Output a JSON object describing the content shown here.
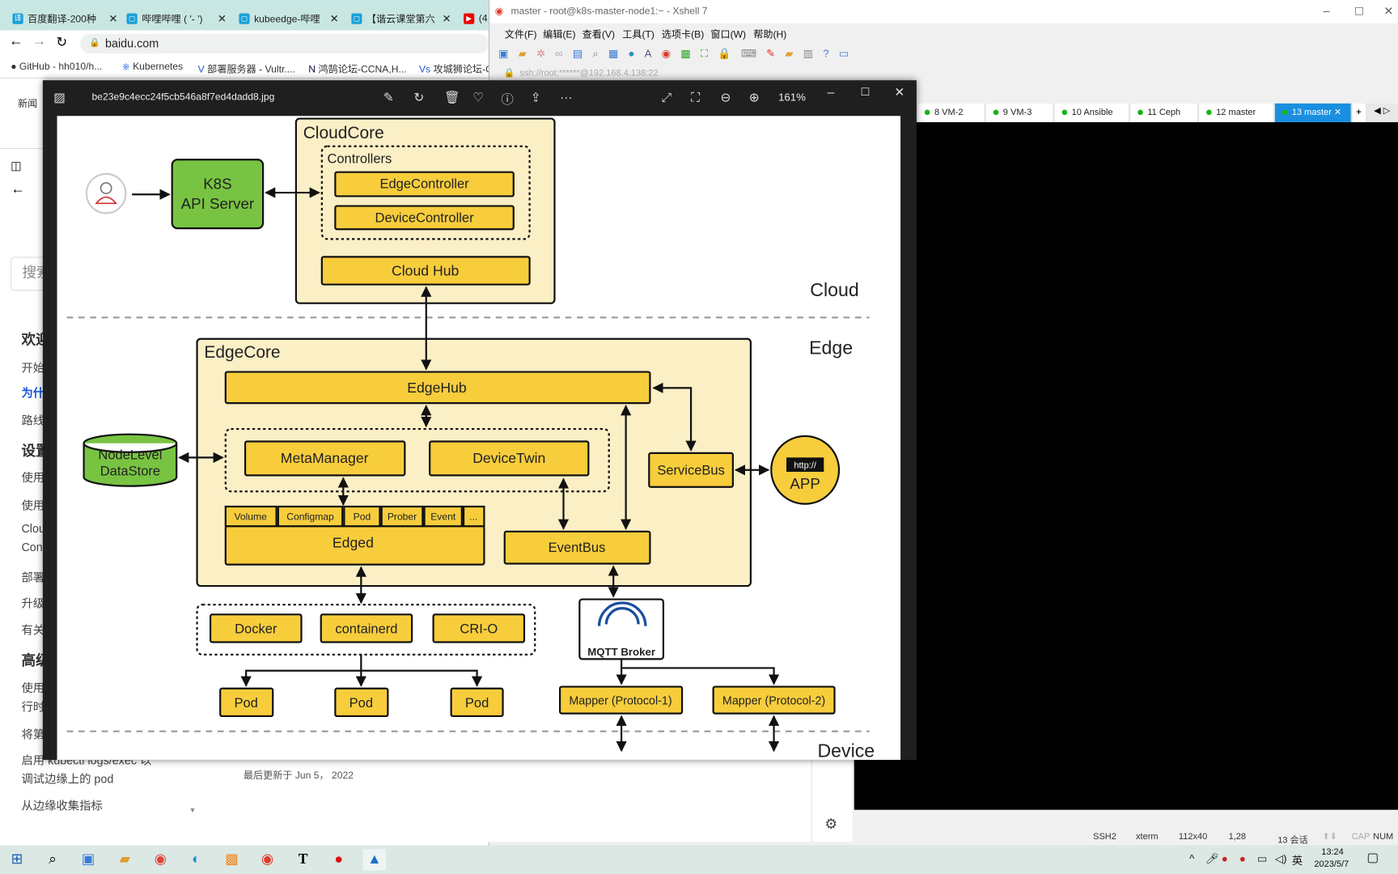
{
  "browser": {
    "tabs": [
      {
        "label": "百度翻译-200种",
        "icon": "translate-icon"
      },
      {
        "label": "哔哩哔哩 ( '- ')",
        "icon": "bilibili-icon"
      },
      {
        "label": "kubeedge-哔哩",
        "icon": "bilibili-icon"
      },
      {
        "label": "【谐云课堂第六",
        "icon": "bilibili-icon"
      },
      {
        "label": "(4",
        "icon": "youtube-icon"
      }
    ],
    "url": "baidu.com",
    "bookmarks": [
      "GitHub - hh010/h...",
      "Kubernetes",
      "部署服务器 - Vultr....",
      "鸿鹄论坛-CCNA,H...",
      "攻城狮论坛-C"
    ],
    "nav_news": "新闻",
    "search_placeholder": "搜索",
    "sidebar": [
      "欢迎",
      "开始",
      "为什",
      "路线",
      "设置",
      "使用",
      "使用",
      "Clou",
      "Con",
      "部署",
      "升级",
      "有关",
      "高级",
      "使用",
      "行时",
      "将第",
      "启用 kubectl logs/exec 以",
      "调试边缘上的 pod",
      "从边缘收集指标"
    ],
    "last_updated": "最后更新于 Jun 5， 2022"
  },
  "xshell": {
    "title": "master - root@k8s-master-node1:~ - Xshell 7",
    "menu": [
      "文件(F)",
      "编辑(E)",
      "查看(V)",
      "工具(T)",
      "选项卡(B)",
      "窗口(W)",
      "帮助(H)"
    ],
    "address": "ssh://root:******@192.168.4.138:22",
    "sessions": [
      {
        "num": "8",
        "name": "VM-2"
      },
      {
        "num": "9",
        "name": "VM-3"
      },
      {
        "num": "10",
        "name": "Ansible"
      },
      {
        "num": "11",
        "name": "Ceph"
      },
      {
        "num": "12",
        "name": "master"
      },
      {
        "num": "13",
        "name": "master",
        "active": true
      }
    ],
    "status": {
      "protocol": "SSH2",
      "term": "xterm",
      "size": "112x40",
      "cursor": "1,28",
      "sessions": "13 会话",
      "cap": "CAP",
      "num": "NUM"
    }
  },
  "viewer": {
    "filename": "be23e9c4ecc24f5cb546a8f7ed4dadd8.jpg",
    "zoom": "161%",
    "diagram": {
      "cloudcore": "CloudCore",
      "controllers": "Controllers",
      "edgecontroller": "EdgeController",
      "devicecontroller": "DeviceController",
      "cloudhub": "Cloud Hub",
      "k8s1": "K8S",
      "k8s2": "API Server",
      "cloud": "Cloud",
      "edge": "Edge",
      "device": "Device",
      "edgecore": "EdgeCore",
      "edgehub": "EdgeHub",
      "metamanager": "MetaManager",
      "devicetwin": "DeviceTwin",
      "nodelevel1": "NodeLevel",
      "nodelevel2": "DataStore",
      "servicebus": "ServiceBus",
      "http": "http://",
      "app": "APP",
      "edged_tabs": [
        "Volume",
        "Configmap",
        "Pod",
        "Prober",
        "Event",
        "..."
      ],
      "edged": "Edged",
      "eventbus": "EventBus",
      "docker": "Docker",
      "containerd": "containerd",
      "crio": "CRI-O",
      "mqtt": "MQTT Broker",
      "pods": [
        "Pod",
        "Pod",
        "Pod"
      ],
      "mapper1": "Mapper (Protocol-1)",
      "mapper2": "Mapper (Protocol-2)"
    },
    "colors": {
      "yellow": "#f7cd3c",
      "cream": "#fbefc6",
      "green": "#78c442"
    }
  },
  "taskbar": {
    "time": "13:24",
    "date": "2023/5/7",
    "ime": "英"
  }
}
